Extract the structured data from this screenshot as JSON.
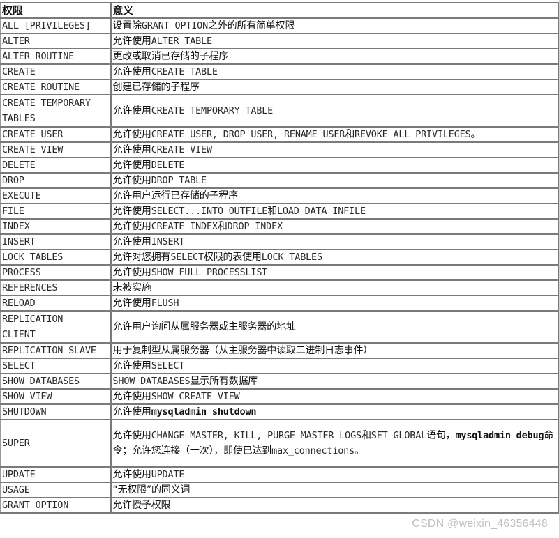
{
  "table": {
    "headers": [
      "权限",
      "意义"
    ],
    "rows": [
      {
        "privilege": "ALL [PRIVILEGES]",
        "parts": [
          {
            "t": "设置除",
            "cn": true
          },
          {
            "t": "GRANT OPTION"
          },
          {
            "t": "之外的所有简单权限",
            "cn": true
          }
        ]
      },
      {
        "privilege": "ALTER",
        "parts": [
          {
            "t": "允许使用",
            "cn": true
          },
          {
            "t": "ALTER TABLE"
          }
        ]
      },
      {
        "privilege": "ALTER ROUTINE",
        "parts": [
          {
            "t": "更改或取消已存储的子程序",
            "cn": true
          }
        ]
      },
      {
        "privilege": "CREATE",
        "parts": [
          {
            "t": "允许使用",
            "cn": true
          },
          {
            "t": "CREATE TABLE"
          }
        ]
      },
      {
        "privilege": "CREATE ROUTINE",
        "parts": [
          {
            "t": "创建已存储的子程序",
            "cn": true
          }
        ]
      },
      {
        "privilege": "CREATE TEMPORARY TABLES",
        "lines": [
          "CREATE TEMPORARY",
          "TABLES"
        ],
        "parts": [
          {
            "t": "允许使用",
            "cn": true
          },
          {
            "t": "CREATE TEMPORARY TABLE"
          }
        ]
      },
      {
        "privilege": "CREATE USER",
        "parts": [
          {
            "t": "允许使用",
            "cn": true
          },
          {
            "t": "CREATE USER, DROP USER, RENAME USER"
          },
          {
            "t": "和",
            "cn": true
          },
          {
            "t": "REVOKE ALL PRIVILEGES"
          },
          {
            "t": "。",
            "cn": true
          }
        ]
      },
      {
        "privilege": "CREATE VIEW",
        "parts": [
          {
            "t": "允许使用",
            "cn": true
          },
          {
            "t": "CREATE VIEW"
          }
        ]
      },
      {
        "privilege": "DELETE",
        "parts": [
          {
            "t": "允许使用",
            "cn": true
          },
          {
            "t": "DELETE"
          }
        ]
      },
      {
        "privilege": "DROP",
        "parts": [
          {
            "t": "允许使用",
            "cn": true
          },
          {
            "t": "DROP TABLE"
          }
        ]
      },
      {
        "privilege": "EXECUTE",
        "parts": [
          {
            "t": "允许用户运行已存储的子程序",
            "cn": true
          }
        ]
      },
      {
        "privilege": "FILE",
        "parts": [
          {
            "t": "允许使用",
            "cn": true
          },
          {
            "t": "SELECT...INTO OUTFILE"
          },
          {
            "t": "和",
            "cn": true
          },
          {
            "t": "LOAD DATA INFILE"
          }
        ]
      },
      {
        "privilege": "INDEX",
        "parts": [
          {
            "t": "允许使用",
            "cn": true
          },
          {
            "t": "CREATE INDEX"
          },
          {
            "t": "和",
            "cn": true
          },
          {
            "t": "DROP INDEX"
          }
        ]
      },
      {
        "privilege": "INSERT",
        "parts": [
          {
            "t": "允许使用",
            "cn": true
          },
          {
            "t": "INSERT"
          }
        ]
      },
      {
        "privilege": "LOCK TABLES",
        "parts": [
          {
            "t": "允许对您拥有",
            "cn": true
          },
          {
            "t": "SELECT"
          },
          {
            "t": "权限的表使用",
            "cn": true
          },
          {
            "t": "LOCK TABLES"
          }
        ]
      },
      {
        "privilege": "PROCESS",
        "parts": [
          {
            "t": "允许使用",
            "cn": true
          },
          {
            "t": "SHOW FULL PROCESSLIST"
          }
        ]
      },
      {
        "privilege": "REFERENCES",
        "parts": [
          {
            "t": "未被实施",
            "cn": true
          }
        ]
      },
      {
        "privilege": "RELOAD",
        "parts": [
          {
            "t": "允许使用",
            "cn": true
          },
          {
            "t": "FLUSH"
          }
        ]
      },
      {
        "privilege": "REPLICATION CLIENT",
        "lines": [
          "REPLICATION",
          "CLIENT"
        ],
        "parts": [
          {
            "t": "允许用户询问从属服务器或主服务器的地址",
            "cn": true
          }
        ]
      },
      {
        "privilege": "REPLICATION SLAVE",
        "parts": [
          {
            "t": "用于复制型从属服务器（从主服务器中读取二进制日志事件）",
            "cn": true
          }
        ]
      },
      {
        "privilege": "SELECT",
        "parts": [
          {
            "t": "允许使用",
            "cn": true
          },
          {
            "t": "SELECT"
          }
        ]
      },
      {
        "privilege": "SHOW DATABASES",
        "parts": [
          {
            "t": "SHOW DATABASES"
          },
          {
            "t": "显示所有数据库",
            "cn": true
          }
        ]
      },
      {
        "privilege": "SHOW VIEW",
        "parts": [
          {
            "t": "允许使用",
            "cn": true
          },
          {
            "t": "SHOW CREATE VIEW"
          }
        ]
      },
      {
        "privilege": "SHUTDOWN",
        "parts": [
          {
            "t": "允许使用",
            "cn": true
          },
          {
            "t": "mysqladmin shutdown",
            "bold": true
          }
        ]
      },
      {
        "privilege": "SUPER",
        "tall3": true,
        "parts": [
          {
            "t": "允许使用",
            "cn": true
          },
          {
            "t": "CHANGE MASTER, KILL, PURGE MASTER LOGS"
          },
          {
            "t": "和",
            "cn": true
          },
          {
            "t": "SET GLOBAL"
          },
          {
            "t": "语句，",
            "cn": true
          },
          {
            "t": "mysqladmin debug",
            "bold": true
          },
          {
            "t": "命令；允许您连接（一次），即使已达到",
            "cn": true
          },
          {
            "t": "max_connections"
          },
          {
            "t": "。",
            "cn": true
          }
        ]
      },
      {
        "privilege": "UPDATE",
        "parts": [
          {
            "t": "允许使用",
            "cn": true
          },
          {
            "t": "UPDATE"
          }
        ]
      },
      {
        "privilege": "USAGE",
        "parts": [
          {
            "t": "“无权限”的同义词",
            "cn": true
          }
        ]
      },
      {
        "privilege": "GRANT OPTION",
        "parts": [
          {
            "t": "允许授予权限",
            "cn": true
          }
        ]
      }
    ]
  },
  "watermark": "CSDN @weixin_46356448"
}
